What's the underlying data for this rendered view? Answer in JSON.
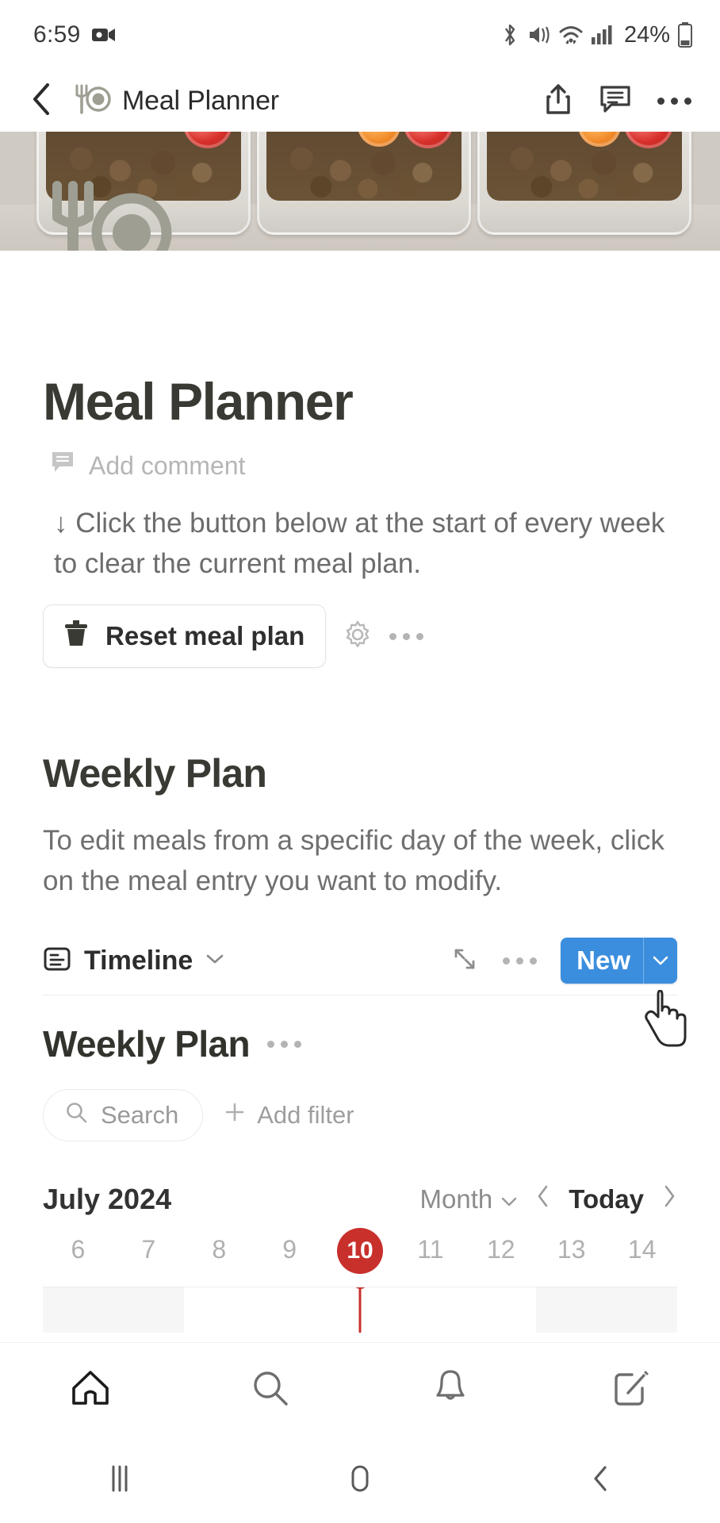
{
  "status_bar": {
    "time": "6:59",
    "battery_percent": "24%",
    "icons": [
      "screen-recorder-icon",
      "bluetooth-icon",
      "mute-vibrate-icon",
      "wifi-icon",
      "cellular-signal-icon",
      "battery-icon"
    ]
  },
  "app_bar": {
    "back_icon": "back-chevron-icon",
    "page_icon": "fork-and-plate-icon",
    "title": "Meal Planner",
    "actions": [
      "share-icon",
      "comment-icon",
      "more-options-icon"
    ]
  },
  "cover": {
    "alt": "meal-prep-containers-photo"
  },
  "page": {
    "emoji_icon": "fork-and-plate-icon",
    "title": "Meal Planner",
    "add_comment_label": "Add comment",
    "callout_text": "↓ Click the button below at the start of every week to clear the current meal plan.",
    "reset_button_label": "Reset meal plan",
    "reset_button_icon": "trash-icon",
    "settings_icon": "gear-icon",
    "more_icon": "more-options-icon"
  },
  "weekly_section": {
    "heading": "Weekly Plan",
    "description": "To edit meals from a specific day of the week, click on the meal entry you want to modify."
  },
  "db_toolbar": {
    "view_icon": "timeline-view-icon",
    "view_label": "Timeline",
    "view_caret": "chevron-down-icon",
    "expand_icon": "expand-icon",
    "more_icon": "more-options-icon",
    "new_label": "New",
    "new_caret": "chevron-down-icon",
    "new_color": "#3b8ede"
  },
  "database": {
    "title": "Weekly Plan",
    "more_icon": "more-options-icon",
    "search_placeholder": "Search",
    "search_icon": "search-icon",
    "add_filter_label": "Add filter",
    "add_filter_icon": "plus-icon"
  },
  "timeline": {
    "month_label": "July 2024",
    "zoom_level": "Month",
    "zoom_caret": "chevron-down-icon",
    "prev_icon": "chevron-left-icon",
    "today_label": "Today",
    "next_icon": "chevron-right-icon",
    "days": [
      "6",
      "7",
      "8",
      "9",
      "10",
      "11",
      "12",
      "13",
      "14"
    ],
    "today_day": "10",
    "today_index": 4,
    "today_marker_color": "#c8302c",
    "weekend_indices": [
      0,
      1,
      7,
      8
    ]
  },
  "bottom_nav": {
    "items": [
      {
        "icon": "home-icon",
        "active": true
      },
      {
        "icon": "search-icon",
        "active": false
      },
      {
        "icon": "bell-icon",
        "active": false
      },
      {
        "icon": "compose-icon",
        "active": false
      }
    ]
  },
  "android_nav": {
    "recents_icon": "recents-icon",
    "home_icon": "home-pill-icon",
    "back_icon": "back-chevron-icon"
  },
  "cursor": {
    "type": "hand-pointer-cursor"
  }
}
